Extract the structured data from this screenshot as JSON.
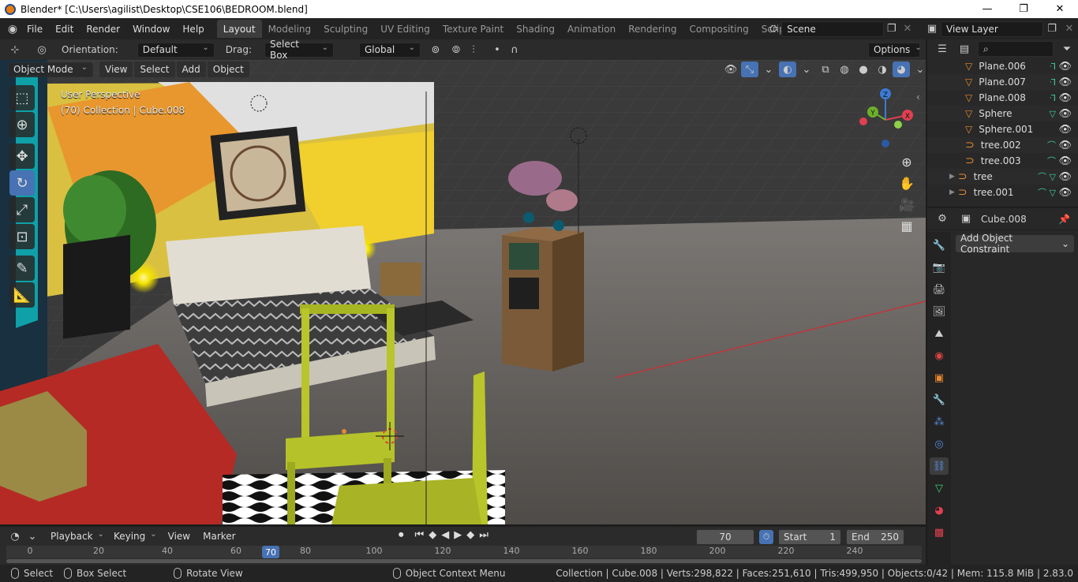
{
  "window": {
    "title": "Blender* [C:\\Users\\agilist\\Desktop\\CSE106\\BEDROOM.blend]",
    "minimize": "—",
    "maximize": "❐",
    "close": "✕"
  },
  "menu": [
    "File",
    "Edit",
    "Render",
    "Window",
    "Help"
  ],
  "workspaces": [
    "Layout",
    "Modeling",
    "Sculpting",
    "UV Editing",
    "Texture Paint",
    "Shading",
    "Animation",
    "Rendering",
    "Compositing",
    "Scripting"
  ],
  "active_workspace": "Layout",
  "scene": "Scene",
  "view_layer": "View Layer",
  "tool_header": {
    "orientation_label": "Orientation:",
    "orientation_value": "Default",
    "drag_label": "Drag:",
    "drag_value": "Select Box",
    "transform": "Global",
    "options": "Options"
  },
  "viewport_header": {
    "mode": "Object Mode",
    "menus": [
      "View",
      "Select",
      "Add",
      "Object"
    ]
  },
  "viewport_info": {
    "line1": "User Perspective",
    "line2": "(70) Collection | Cube.008"
  },
  "gizmo": {
    "z": "Z",
    "y": "Y",
    "x": "X"
  },
  "outliner": [
    {
      "name": "Plane.006",
      "type": "mesh",
      "extra": "ᒬ"
    },
    {
      "name": "Plane.007",
      "type": "mesh",
      "extra": "ᒬ"
    },
    {
      "name": "Plane.008",
      "type": "mesh",
      "extra": "ᒬ"
    },
    {
      "name": "Sphere",
      "type": "mesh",
      "extra": "▽"
    },
    {
      "name": "Sphere.001",
      "type": "mesh",
      "extra": ""
    },
    {
      "name": "tree.002",
      "type": "curve",
      "extra": "⌒"
    },
    {
      "name": "tree.003",
      "type": "curve",
      "extra": "⌒"
    },
    {
      "name": "tree",
      "type": "curve",
      "extra": "⌒ ▽"
    },
    {
      "name": "tree.001",
      "type": "curve",
      "extra": "⌒ ▽"
    }
  ],
  "properties": {
    "object": "Cube.008",
    "add_constraint": "Add Object Constraint"
  },
  "timeline": {
    "menus": [
      "Playback",
      "Keying",
      "View",
      "Marker"
    ],
    "current_frame": "70",
    "start_label": "Start",
    "start": "1",
    "end_label": "End",
    "end": "250",
    "ticks": [
      "0",
      "20",
      "40",
      "60",
      "80",
      "100",
      "120",
      "140",
      "160",
      "180",
      "200",
      "220",
      "240"
    ],
    "frame_marker": "70"
  },
  "status": {
    "select": "Select",
    "box_select": "Box Select",
    "rotate": "Rotate View",
    "context": "Object Context Menu",
    "stats": "Collection | Cube.008 | Verts:298,822 | Faces:251,610 | Tris:499,950 | Objects:0/42 | Mem: 115.8 MiB | 2.83.0"
  },
  "colors": {
    "accent": "#4772b3",
    "orange": "#e8892f"
  }
}
